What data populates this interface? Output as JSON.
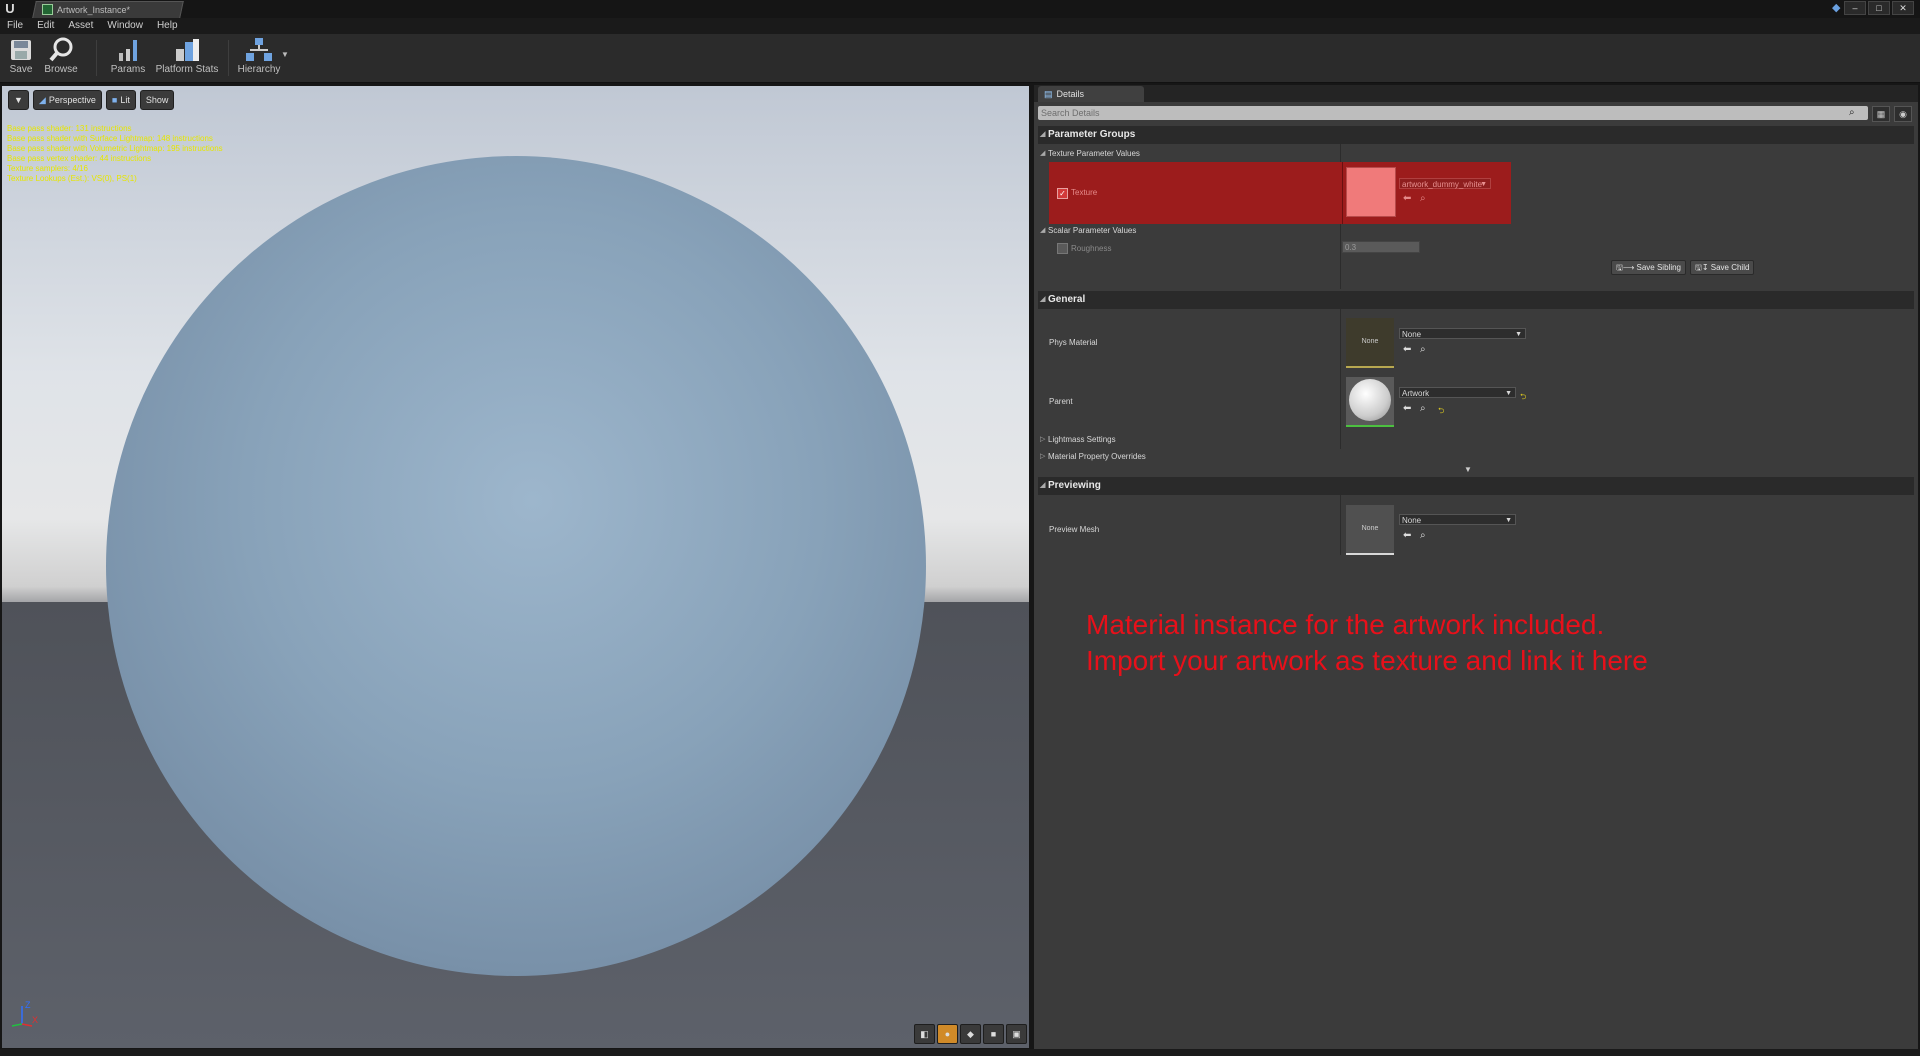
{
  "window": {
    "tab_title": "Artwork_Instance*",
    "controls": {
      "minimize": "–",
      "maximize": "□",
      "close": "✕"
    }
  },
  "menu": [
    "File",
    "Edit",
    "Asset",
    "Window",
    "Help"
  ],
  "toolbar": {
    "save": "Save",
    "browse": "Browse",
    "params": "Params",
    "platform_stats": "Platform Stats",
    "hierarchy": "Hierarchy"
  },
  "viewport": {
    "perspective": "Perspective",
    "lit": "Lit",
    "show": "Show",
    "stats": [
      "Base pass shader: 131 instructions",
      "Base pass shader with Surface Lightmap: 148 instructions",
      "Base pass shader with Volumetric Lightmap: 195 instructions",
      "Base pass vertex shader: 44 instructions",
      "Texture samplers: 4/16",
      "Texture Lookups (Est.): VS(0), PS(1)"
    ],
    "axis": {
      "x": "X",
      "z": "Z"
    }
  },
  "details": {
    "tab": "Details",
    "search_placeholder": "Search Details",
    "parameter_groups": "Parameter Groups",
    "texture_param_values": "Texture Parameter Values",
    "texture_label": "Texture",
    "texture_asset": "artwork_dummy_white",
    "scalar_param_values": "Scalar Parameter Values",
    "roughness_label": "Roughness",
    "roughness_value": "0.3",
    "save_sibling": "Save Sibling",
    "save_child": "Save Child",
    "general": "General",
    "phys_material_label": "Phys Material",
    "phys_material_value": "None",
    "phys_thumb_text": "None",
    "parent_label": "Parent",
    "parent_value": "Artwork",
    "lightmass_settings": "Lightmass Settings",
    "material_property_overrides": "Material Property Overrides",
    "previewing": "Previewing",
    "preview_mesh_label": "Preview Mesh",
    "preview_mesh_value": "None",
    "preview_thumb_text": "None"
  },
  "annotation": {
    "line1": "Material instance for the artwork included.",
    "line2": "Import your artwork as texture and link it here"
  },
  "colors": {
    "highlight": "#9c1c1c",
    "texture_swatch": "#f07a7a",
    "annotation": "#e8101a",
    "stats": "#e6e600"
  }
}
